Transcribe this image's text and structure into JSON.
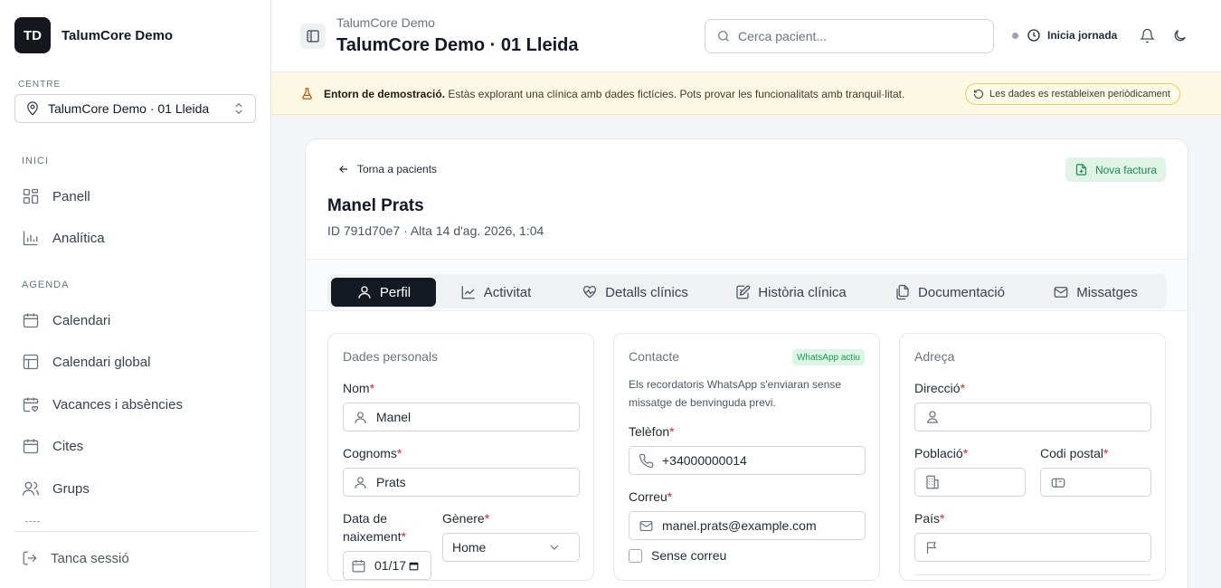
{
  "sidebar": {
    "logo_initials": "TD",
    "brand_name": "TalumCore Demo",
    "centre_label": "CENTRE",
    "centre_value": "TalumCore Demo · 01 Lleida",
    "sections": [
      {
        "label": "INICI",
        "items": [
          {
            "label": "Panell",
            "icon": "grid-icon"
          },
          {
            "label": "Analítica",
            "icon": "bar-chart-icon"
          }
        ]
      },
      {
        "label": "AGENDA",
        "items": [
          {
            "label": "Calendari",
            "icon": "calendar-icon"
          },
          {
            "label": "Calendari global",
            "icon": "layout-icon"
          },
          {
            "label": "Vacances i absències",
            "icon": "calendar-heart-icon"
          },
          {
            "label": "Cites",
            "icon": "calendar-icon"
          },
          {
            "label": "Grups",
            "icon": "users-icon"
          }
        ]
      }
    ],
    "logout_label": "Tanca sessió"
  },
  "header": {
    "subtitle": "TalumCore Demo",
    "title": "TalumCore Demo · 01 Lleida",
    "search_placeholder": "Cerca pacient...",
    "jornada_label": "Inicia jornada"
  },
  "banner": {
    "bold": "Entorn de demostració.",
    "text": " Estàs explorant una clínica amb dades fictícies. Pots provar les funcionalitats amb tranquil·litat.",
    "pill": "Les dades es restableixen periòdicament"
  },
  "patient": {
    "back_label": "Torna a pacients",
    "invoice_label": "Nova factura",
    "name": "Manel Prats",
    "meta": "ID 791d70e7 · Alta 14 d'ag. 2026, 1:04"
  },
  "tabs": [
    {
      "label": "Perfil",
      "active": true
    },
    {
      "label": "Activitat"
    },
    {
      "label": "Detalls clínics"
    },
    {
      "label": "Història clínica"
    },
    {
      "label": "Documentació"
    },
    {
      "label": "Missatges"
    }
  ],
  "personal": {
    "title": "Dades personals",
    "nom_label": "Nom",
    "nom_value": "Manel",
    "cognoms_label": "Cognoms",
    "cognoms_value": "Prats",
    "birth_label_1": "Data de",
    "birth_label_2": "naixement",
    "birth_value": "01/17",
    "gender_label": "Gènere",
    "gender_value": "Home"
  },
  "contact": {
    "title": "Contacte",
    "badge": "WhatsApp actiu",
    "note": "Els recordatoris WhatsApp s'enviaran sense missatge de benvinguda previ.",
    "phone_label": "Telèfon",
    "phone_value": "+34000000014",
    "email_label": "Correu",
    "email_value": "manel.prats@example.com",
    "no_email_label": "Sense correu"
  },
  "address": {
    "title": "Adreça",
    "direccio_label": "Direcció",
    "poblacio_label": "Població",
    "postal_label": "Codi postal",
    "pais_label": "País"
  },
  "required_mark": "*"
}
